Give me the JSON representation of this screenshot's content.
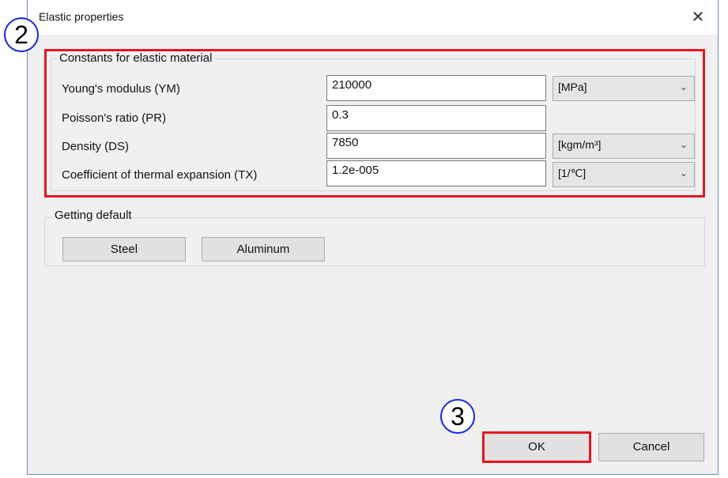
{
  "dialog": {
    "title": "Elastic properties",
    "close_glyph": "✕"
  },
  "callouts": {
    "step2": "2",
    "step3": "3"
  },
  "constants": {
    "legend": "Constants for elastic material",
    "rows": [
      {
        "label": "Young's modulus (YM)",
        "value": "210000",
        "unit": "[MPa]"
      },
      {
        "label": "Poisson's ratio (PR)",
        "value": "0.3",
        "unit": ""
      },
      {
        "label": "Density (DS)",
        "value": "7850",
        "unit": "[kgm/m³]"
      },
      {
        "label": "Coefficient of thermal expansion (TX)",
        "value": "1.2e-005",
        "unit": "[1/℃]"
      }
    ]
  },
  "defaults": {
    "legend": "Getting default",
    "steel_label": "Steel",
    "aluminum_label": "Aluminum"
  },
  "footer": {
    "ok_label": "OK",
    "cancel_label": "Cancel"
  },
  "colors": {
    "highlight": "#e8141e",
    "callout": "#1428e0",
    "dialog_bg": "#f0f0f0",
    "window_border": "#6d8fc7"
  },
  "icons": {
    "dropdown": "chevron-down-icon",
    "close": "close-icon"
  }
}
